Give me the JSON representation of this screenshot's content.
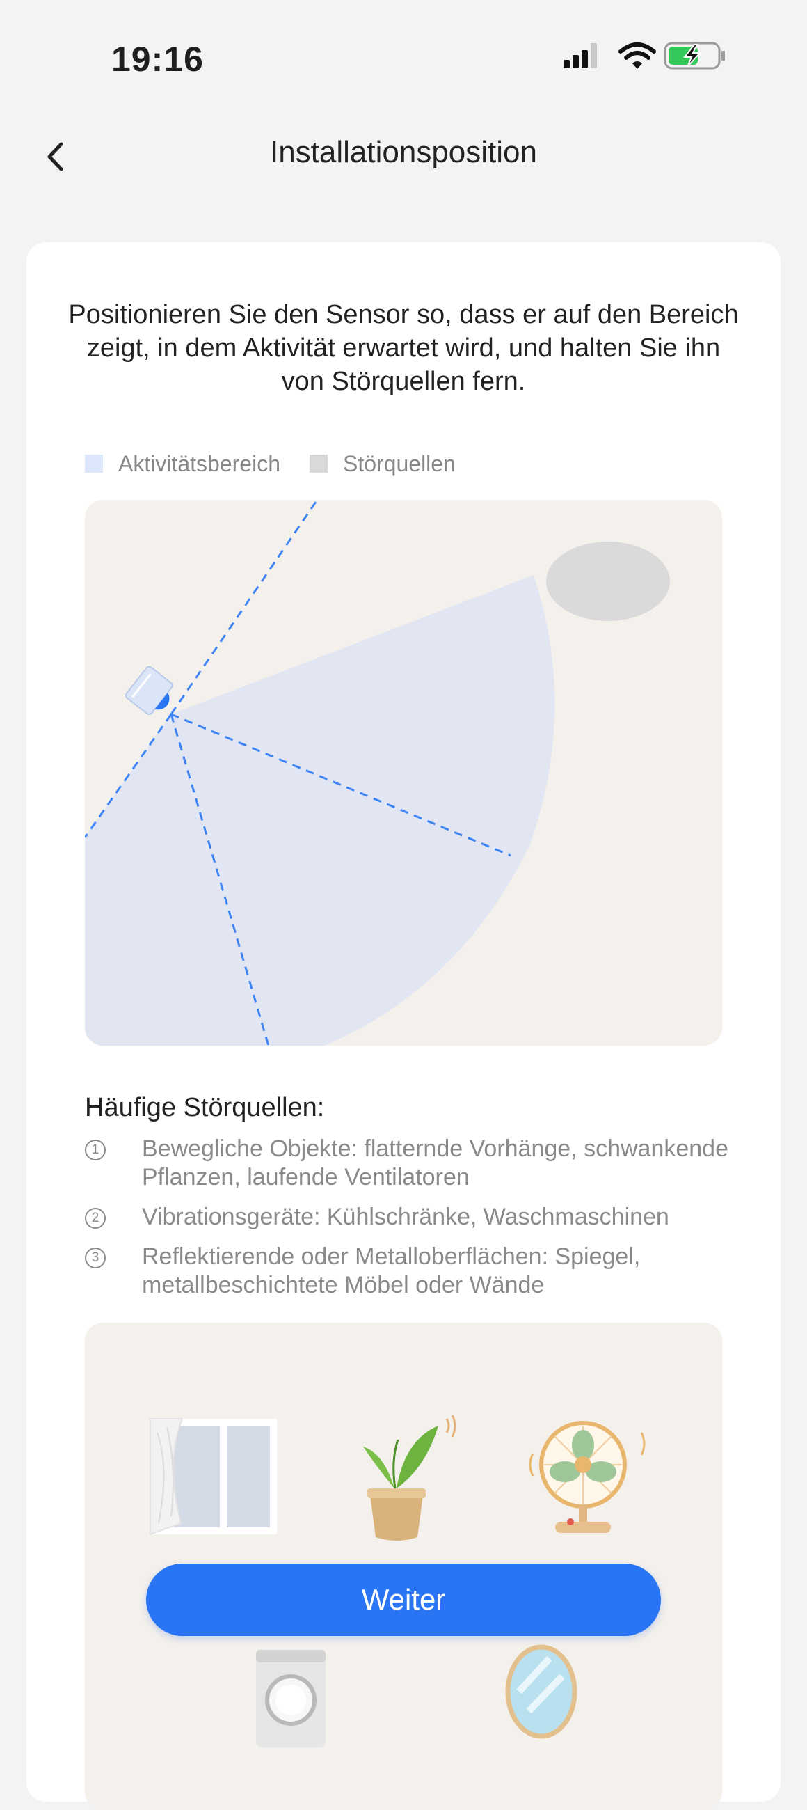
{
  "status_bar": {
    "time": "19:16",
    "icons": [
      "cellular-signal-icon",
      "wifi-icon",
      "battery-charging-icon"
    ],
    "battery_color": "#34c759"
  },
  "header": {
    "title": "Installationsposition",
    "back_icon": "chevron-left-icon"
  },
  "intro_text": "Positionieren Sie den Sensor so, dass er auf den Bereich zeigt, in dem Aktivität erwartet wird, und halten Sie ihn von Störquellen fern.",
  "legend": [
    {
      "label": "Aktivitätsbereich",
      "color": "#dde7fb"
    },
    {
      "label": "Störquellen",
      "color": "#d9d9d9"
    }
  ],
  "diagram": {
    "background": "#f4f1ec",
    "coverage_color": "#e1e6f2",
    "line_color": "#3f84f4",
    "sensor_color": "#2a75f3",
    "interference_color": "#dadada"
  },
  "common_sources": {
    "title": "Häufige Störquellen:",
    "items": [
      {
        "number": "1",
        "text": "Bewegliche Objekte: flatternde Vorhänge, schwankende Pflanzen, laufende Ventilatoren"
      },
      {
        "number": "2",
        "text": "Vibrationsgeräte: Kühlschränke, Waschmaschinen"
      },
      {
        "number": "3",
        "text": "Reflektierende oder Metalloberflächen: Spiegel, metallbeschichtete Möbel oder Wände"
      }
    ]
  },
  "illustrations": [
    "curtain-window-icon",
    "plant-icon",
    "fan-icon",
    "washing-machine-icon",
    "mirror-icon"
  ],
  "primary_button": {
    "label": "Weiter",
    "color": "#2a75f3"
  }
}
